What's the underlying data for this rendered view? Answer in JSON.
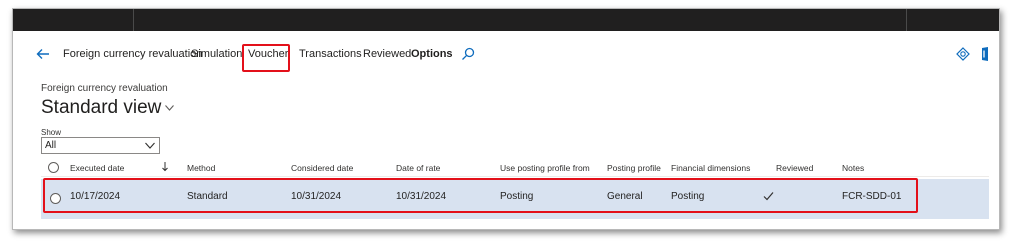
{
  "action_bar": {
    "items": [
      {
        "label": "Foreign currency revaluation",
        "bold": false
      },
      {
        "label": "Simulation",
        "bold": false
      },
      {
        "label": "Voucher",
        "bold": false,
        "highlighted": true
      },
      {
        "label": "Transactions",
        "bold": false
      },
      {
        "label": "Reviewed",
        "bold": false
      },
      {
        "label": "Options",
        "bold": true
      }
    ],
    "icons": [
      "back-arrow-icon",
      "search-icon",
      "refresh-icon",
      "office-icon"
    ]
  },
  "page": {
    "breadcrumb": "Foreign currency revaluation",
    "title": "Standard view"
  },
  "filter": {
    "label": "Show",
    "value": "All"
  },
  "grid": {
    "columns": [
      "Executed date",
      "Method",
      "Considered date",
      "Date of rate",
      "Use posting profile from",
      "Posting profile",
      "Financial dimensions",
      "Reviewed",
      "Notes"
    ],
    "rows": [
      {
        "executed_date": "10/17/2024",
        "method": "Standard",
        "considered_date": "10/31/2024",
        "date_of_rate": "10/31/2024",
        "use_posting_profile_from": "Posting",
        "posting_profile": "General",
        "financial_dimensions": "Posting",
        "reviewed": true,
        "notes": "FCR-SDD-01"
      }
    ]
  },
  "colors": {
    "accent": "#0f6cbd",
    "highlight_box": "#e3101a",
    "selected_row": "#d8e2f0",
    "top_bar": "#201f1f"
  }
}
